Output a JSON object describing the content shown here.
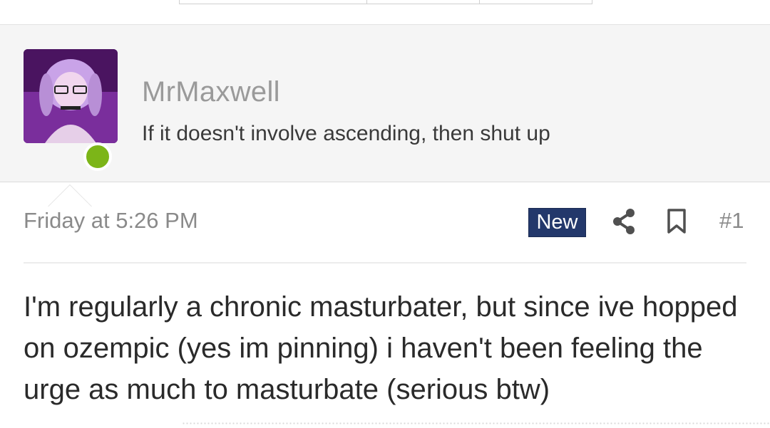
{
  "user": {
    "username": "MrMaxwell",
    "title": "If it doesn't involve ascending, then shut up",
    "online_status_color": "#7cb518"
  },
  "post": {
    "date": "Friday at 5:26 PM",
    "badge": "New",
    "badge_color": "#23386b",
    "number": "#1",
    "body": "I'm regularly a chronic masturbater, but since ive hopped on ozempic (yes im pinning) i haven't been feeling the urge as much to masturbate (serious btw)"
  },
  "icons": {
    "share": "share-icon",
    "bookmark": "bookmark-icon"
  }
}
